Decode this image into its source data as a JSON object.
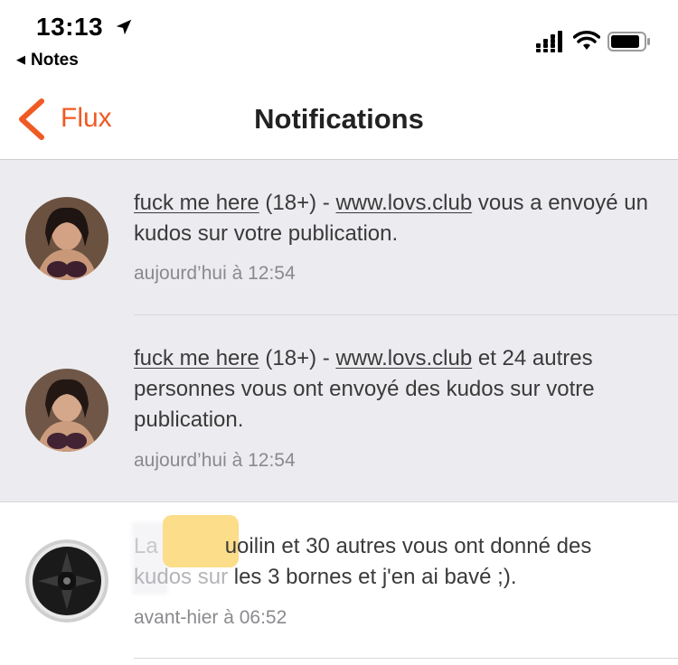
{
  "status_bar": {
    "time": "13:13",
    "back_app": "Notes"
  },
  "nav": {
    "back_label": "Flux",
    "title": "Notifications"
  },
  "notifications": [
    {
      "name": "fuck me here",
      "age_tag": "(18+)",
      "dash": "-",
      "link": "www.lovs.club",
      "text": "vous a envoyé un kudos sur votre publication.",
      "timestamp": "aujourd’hui à 12:54"
    },
    {
      "name": "fuck me here",
      "age_tag": "(18+)",
      "dash": "-",
      "link": "www.lovs.club",
      "text": "et 24 autres personnes vous ont envoyé des kudos sur votre publication.",
      "timestamp": "aujourd’hui à 12:54"
    },
    {
      "name_prefix": "La",
      "name_suffix": "uoilin",
      "text_line1": "et 30 autres vous ont donné des",
      "text_line2_prefix": "kudos",
      "text_line2_hidden": "sur",
      "text_line2": "les 3 bornes et j'en ai bavé ;).",
      "timestamp": "avant-hier à 06:52"
    }
  ],
  "colors": {
    "accent": "#f05a24",
    "unread_bg": "#ececf0",
    "highlight": "#fbdb84"
  }
}
